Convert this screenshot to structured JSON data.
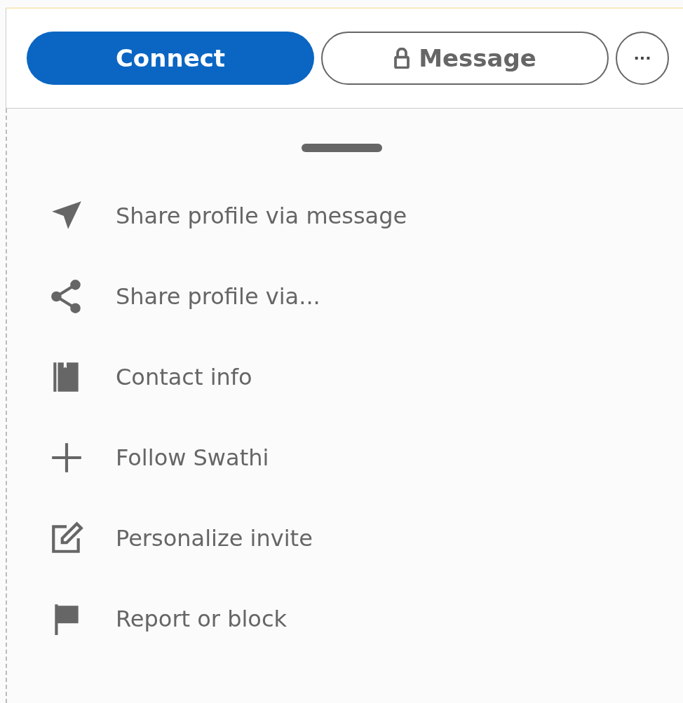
{
  "actions": [
    {
      "kind": "primary",
      "label": "Connect"
    },
    {
      "kind": "locked",
      "label": "Message"
    },
    {
      "kind": "more",
      "label": "···"
    }
  ],
  "menu": [
    {
      "kind": "send",
      "label": "Share profile via message"
    },
    {
      "kind": "share",
      "label": "Share profile via..."
    },
    {
      "kind": "contact",
      "label": "Contact info"
    },
    {
      "kind": "plus",
      "label": "Follow Swathi"
    },
    {
      "kind": "edit",
      "label": "Personalize invite"
    },
    {
      "kind": "flag",
      "label": "Report or block"
    }
  ]
}
